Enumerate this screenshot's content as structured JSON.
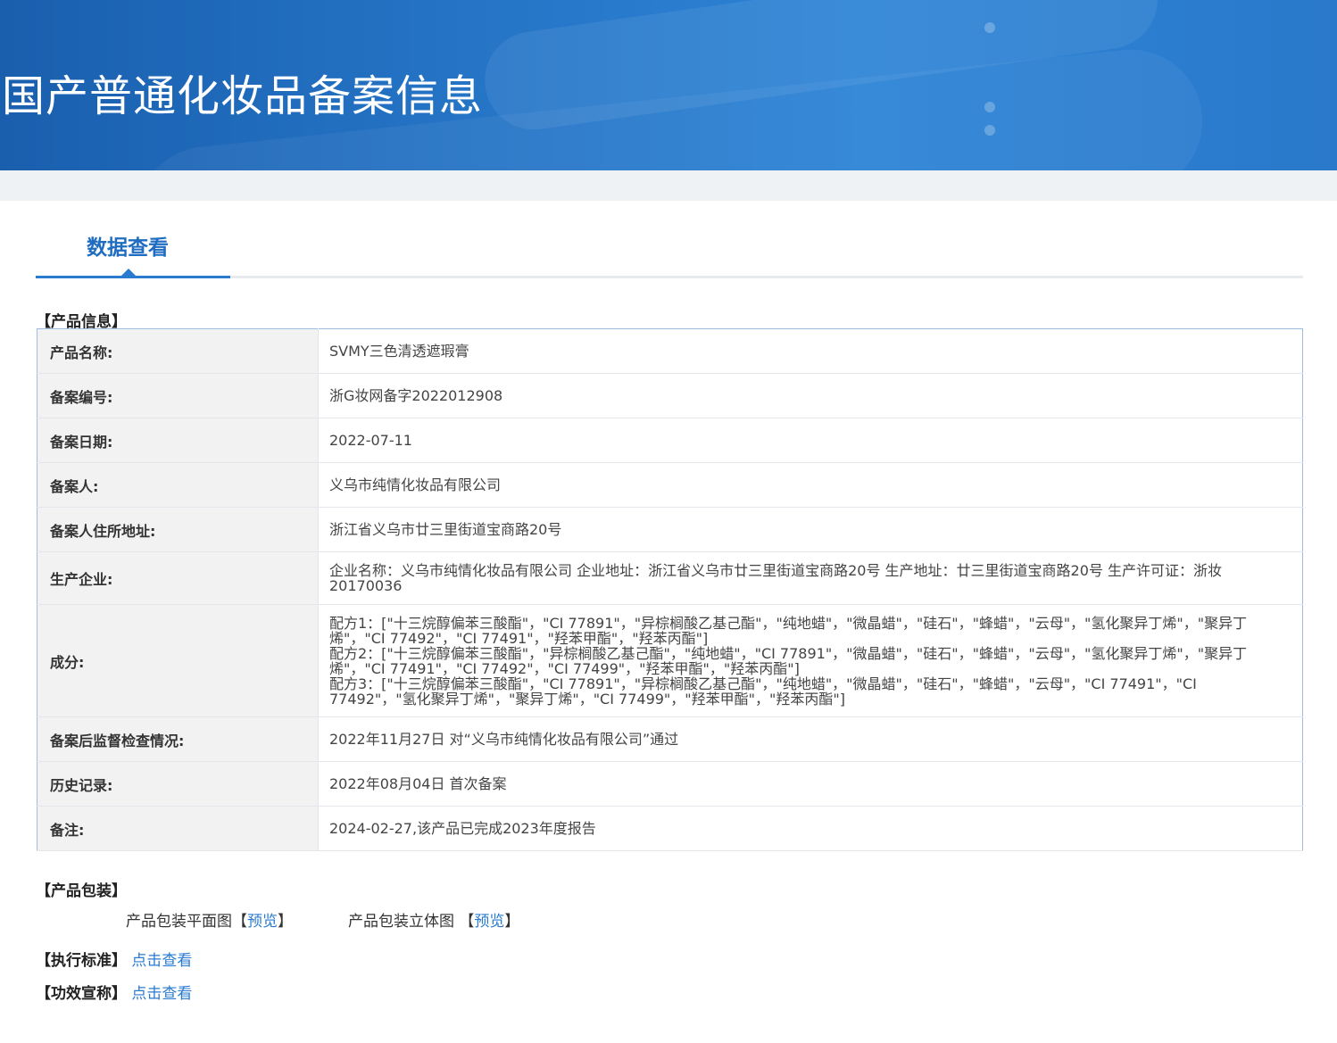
{
  "header": {
    "title": "国产普通化妆品备案信息"
  },
  "tab": {
    "label": "数据查看"
  },
  "product_info": {
    "section_label": "【产品信息】",
    "rows": [
      {
        "key": "产品名称:",
        "value": "SVMY三色清透遮瑕膏"
      },
      {
        "key": "备案编号:",
        "value": "浙G妆网备字2022012908"
      },
      {
        "key": "备案日期:",
        "value": "2022-07-11"
      },
      {
        "key": "备案人:",
        "value": "义乌市纯情化妆品有限公司"
      },
      {
        "key": "备案人住所地址:",
        "value": "浙江省义乌市廿三里街道宝商路20号"
      },
      {
        "key": "生产企业:",
        "value": "企业名称：义乌市纯情化妆品有限公司 企业地址：浙江省义乌市廿三里街道宝商路20号 生产地址：廿三里街道宝商路20号 生产许可证：浙妆20170036"
      },
      {
        "key": "成分:",
        "lines": [
          "配方1：[\"十三烷醇偏苯三酸酯\"，\"CI 77891\"，\"异棕榈酸乙基己酯\"，\"纯地蜡\"，\"微晶蜡\"，\"硅石\"，\"蜂蜡\"，\"云母\"，\"氢化聚异丁烯\"，\"聚异丁烯\"，\"CI 77492\"，\"CI 77491\"，\"羟苯甲酯\"，\"羟苯丙酯\"]",
          "配方2：[\"十三烷醇偏苯三酸酯\"，\"异棕榈酸乙基己酯\"，\"纯地蜡\"，\"CI 77891\"，\"微晶蜡\"，\"硅石\"，\"蜂蜡\"，\"云母\"，\"氢化聚异丁烯\"，\"聚异丁烯\"，\"CI 77491\"，\"CI 77492\"，\"CI 77499\"，\"羟苯甲酯\"，\"羟苯丙酯\"]",
          "配方3：[\"十三烷醇偏苯三酸酯\"，\"CI 77891\"，\"异棕榈酸乙基己酯\"，\"纯地蜡\"，\"微晶蜡\"，\"硅石\"，\"蜂蜡\"，\"云母\"，\"CI 77491\"，\"CI 77492\"，\"氢化聚异丁烯\"，\"聚异丁烯\"，\"CI 77499\"，\"羟苯甲酯\"，\"羟苯丙酯\"]"
        ]
      },
      {
        "key": "备案后监督检查情况:",
        "value": "2022年11月27日 对“义乌市纯情化妆品有限公司”通过"
      },
      {
        "key": "历史记录:",
        "value": "2022年08月04日 首次备案"
      },
      {
        "key": "备注:",
        "value": "2024-02-27,该产品已完成2023年度报告"
      }
    ]
  },
  "packaging": {
    "section_label": "【产品包装】",
    "flat_label": "产品包装平面图",
    "stereo_label": "产品包装立体图",
    "bracket_open": "【",
    "bracket_close": "】",
    "preview_label": "预览"
  },
  "standard": {
    "label": "【执行标准】",
    "link": "点击查看"
  },
  "efficacy": {
    "label": "【功效宣称】",
    "link": "点击查看"
  }
}
